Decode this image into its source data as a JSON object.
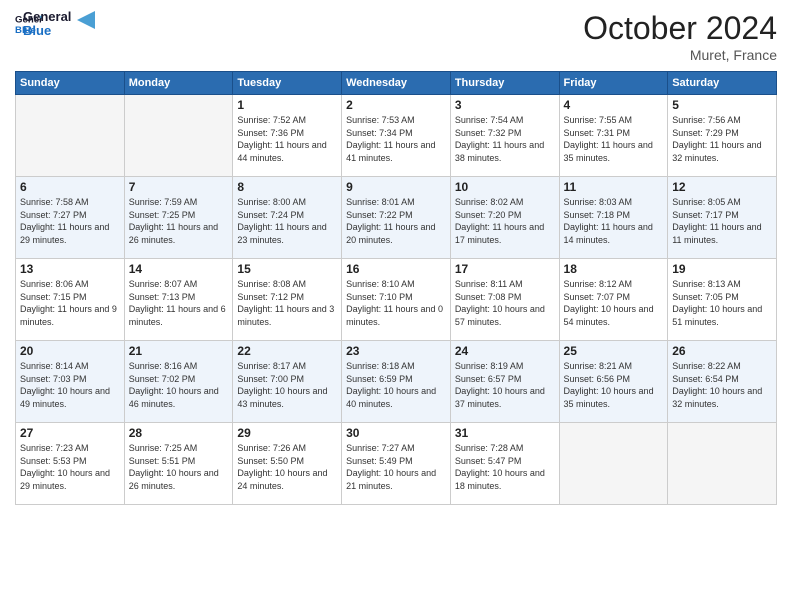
{
  "header": {
    "logo_general": "General",
    "logo_blue": "Blue",
    "month_title": "October 2024",
    "location": "Muret, France"
  },
  "weekdays": [
    "Sunday",
    "Monday",
    "Tuesday",
    "Wednesday",
    "Thursday",
    "Friday",
    "Saturday"
  ],
  "weeks": [
    [
      {
        "day": "",
        "sunrise": "",
        "sunset": "",
        "daylight": ""
      },
      {
        "day": "",
        "sunrise": "",
        "sunset": "",
        "daylight": ""
      },
      {
        "day": "1",
        "sunrise": "Sunrise: 7:52 AM",
        "sunset": "Sunset: 7:36 PM",
        "daylight": "Daylight: 11 hours and 44 minutes."
      },
      {
        "day": "2",
        "sunrise": "Sunrise: 7:53 AM",
        "sunset": "Sunset: 7:34 PM",
        "daylight": "Daylight: 11 hours and 41 minutes."
      },
      {
        "day": "3",
        "sunrise": "Sunrise: 7:54 AM",
        "sunset": "Sunset: 7:32 PM",
        "daylight": "Daylight: 11 hours and 38 minutes."
      },
      {
        "day": "4",
        "sunrise": "Sunrise: 7:55 AM",
        "sunset": "Sunset: 7:31 PM",
        "daylight": "Daylight: 11 hours and 35 minutes."
      },
      {
        "day": "5",
        "sunrise": "Sunrise: 7:56 AM",
        "sunset": "Sunset: 7:29 PM",
        "daylight": "Daylight: 11 hours and 32 minutes."
      }
    ],
    [
      {
        "day": "6",
        "sunrise": "Sunrise: 7:58 AM",
        "sunset": "Sunset: 7:27 PM",
        "daylight": "Daylight: 11 hours and 29 minutes."
      },
      {
        "day": "7",
        "sunrise": "Sunrise: 7:59 AM",
        "sunset": "Sunset: 7:25 PM",
        "daylight": "Daylight: 11 hours and 26 minutes."
      },
      {
        "day": "8",
        "sunrise": "Sunrise: 8:00 AM",
        "sunset": "Sunset: 7:24 PM",
        "daylight": "Daylight: 11 hours and 23 minutes."
      },
      {
        "day": "9",
        "sunrise": "Sunrise: 8:01 AM",
        "sunset": "Sunset: 7:22 PM",
        "daylight": "Daylight: 11 hours and 20 minutes."
      },
      {
        "day": "10",
        "sunrise": "Sunrise: 8:02 AM",
        "sunset": "Sunset: 7:20 PM",
        "daylight": "Daylight: 11 hours and 17 minutes."
      },
      {
        "day": "11",
        "sunrise": "Sunrise: 8:03 AM",
        "sunset": "Sunset: 7:18 PM",
        "daylight": "Daylight: 11 hours and 14 minutes."
      },
      {
        "day": "12",
        "sunrise": "Sunrise: 8:05 AM",
        "sunset": "Sunset: 7:17 PM",
        "daylight": "Daylight: 11 hours and 11 minutes."
      }
    ],
    [
      {
        "day": "13",
        "sunrise": "Sunrise: 8:06 AM",
        "sunset": "Sunset: 7:15 PM",
        "daylight": "Daylight: 11 hours and 9 minutes."
      },
      {
        "day": "14",
        "sunrise": "Sunrise: 8:07 AM",
        "sunset": "Sunset: 7:13 PM",
        "daylight": "Daylight: 11 hours and 6 minutes."
      },
      {
        "day": "15",
        "sunrise": "Sunrise: 8:08 AM",
        "sunset": "Sunset: 7:12 PM",
        "daylight": "Daylight: 11 hours and 3 minutes."
      },
      {
        "day": "16",
        "sunrise": "Sunrise: 8:10 AM",
        "sunset": "Sunset: 7:10 PM",
        "daylight": "Daylight: 11 hours and 0 minutes."
      },
      {
        "day": "17",
        "sunrise": "Sunrise: 8:11 AM",
        "sunset": "Sunset: 7:08 PM",
        "daylight": "Daylight: 10 hours and 57 minutes."
      },
      {
        "day": "18",
        "sunrise": "Sunrise: 8:12 AM",
        "sunset": "Sunset: 7:07 PM",
        "daylight": "Daylight: 10 hours and 54 minutes."
      },
      {
        "day": "19",
        "sunrise": "Sunrise: 8:13 AM",
        "sunset": "Sunset: 7:05 PM",
        "daylight": "Daylight: 10 hours and 51 minutes."
      }
    ],
    [
      {
        "day": "20",
        "sunrise": "Sunrise: 8:14 AM",
        "sunset": "Sunset: 7:03 PM",
        "daylight": "Daylight: 10 hours and 49 minutes."
      },
      {
        "day": "21",
        "sunrise": "Sunrise: 8:16 AM",
        "sunset": "Sunset: 7:02 PM",
        "daylight": "Daylight: 10 hours and 46 minutes."
      },
      {
        "day": "22",
        "sunrise": "Sunrise: 8:17 AM",
        "sunset": "Sunset: 7:00 PM",
        "daylight": "Daylight: 10 hours and 43 minutes."
      },
      {
        "day": "23",
        "sunrise": "Sunrise: 8:18 AM",
        "sunset": "Sunset: 6:59 PM",
        "daylight": "Daylight: 10 hours and 40 minutes."
      },
      {
        "day": "24",
        "sunrise": "Sunrise: 8:19 AM",
        "sunset": "Sunset: 6:57 PM",
        "daylight": "Daylight: 10 hours and 37 minutes."
      },
      {
        "day": "25",
        "sunrise": "Sunrise: 8:21 AM",
        "sunset": "Sunset: 6:56 PM",
        "daylight": "Daylight: 10 hours and 35 minutes."
      },
      {
        "day": "26",
        "sunrise": "Sunrise: 8:22 AM",
        "sunset": "Sunset: 6:54 PM",
        "daylight": "Daylight: 10 hours and 32 minutes."
      }
    ],
    [
      {
        "day": "27",
        "sunrise": "Sunrise: 7:23 AM",
        "sunset": "Sunset: 5:53 PM",
        "daylight": "Daylight: 10 hours and 29 minutes."
      },
      {
        "day": "28",
        "sunrise": "Sunrise: 7:25 AM",
        "sunset": "Sunset: 5:51 PM",
        "daylight": "Daylight: 10 hours and 26 minutes."
      },
      {
        "day": "29",
        "sunrise": "Sunrise: 7:26 AM",
        "sunset": "Sunset: 5:50 PM",
        "daylight": "Daylight: 10 hours and 24 minutes."
      },
      {
        "day": "30",
        "sunrise": "Sunrise: 7:27 AM",
        "sunset": "Sunset: 5:49 PM",
        "daylight": "Daylight: 10 hours and 21 minutes."
      },
      {
        "day": "31",
        "sunrise": "Sunrise: 7:28 AM",
        "sunset": "Sunset: 5:47 PM",
        "daylight": "Daylight: 10 hours and 18 minutes."
      },
      {
        "day": "",
        "sunrise": "",
        "sunset": "",
        "daylight": ""
      },
      {
        "day": "",
        "sunrise": "",
        "sunset": "",
        "daylight": ""
      }
    ]
  ]
}
